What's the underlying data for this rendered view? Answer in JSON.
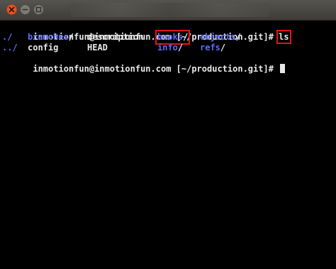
{
  "window": {
    "close_icon": "close-icon",
    "minimize_icon": "minimize-icon",
    "maximize_icon": "maximize-icon"
  },
  "terminal": {
    "prompt1": "inmotionfun@inmotionfun.com [~/production.git]# ",
    "command1": "ls",
    "ls_rows": [
      [
        {
          "name": "./",
          "type": "dir"
        },
        {
          "name": "branches",
          "type": "dir"
        },
        {
          "name": "description",
          "type": "file"
        },
        {
          "name": "hooks",
          "type": "dir"
        },
        {
          "name": "objects",
          "type": "dir"
        }
      ],
      [
        {
          "name": "../",
          "type": "dir"
        },
        {
          "name": "config",
          "type": "file"
        },
        {
          "name": "HEAD",
          "type": "file"
        },
        {
          "name": "info",
          "type": "dir"
        },
        {
          "name": "refs",
          "type": "dir"
        }
      ]
    ],
    "prompt2": "inmotionfun@inmotionfun.com [~/production.git]# ",
    "highlight_color": "#e3141b",
    "dir_color": "#5e6cf5",
    "text_color": "#e8e8e8",
    "background_color": "#000000"
  }
}
